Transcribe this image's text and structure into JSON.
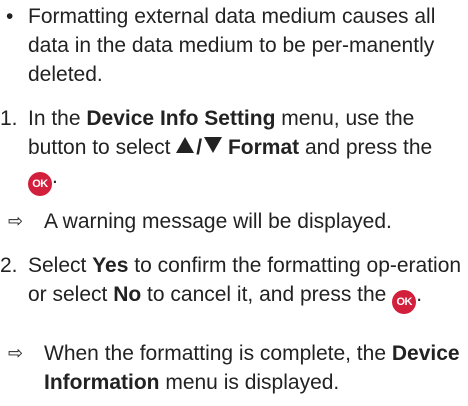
{
  "note": {
    "bullet": "•",
    "text": "Formatting external data medium causes all data in the data medium to be per-manently deleted."
  },
  "step1": {
    "number": "1.",
    "text_a": "In the ",
    "menu_name": "Device Info Setting",
    "text_b": " menu, use the button to select ",
    "slash": "/",
    "format_label": "Format",
    "text_c": " and press the ",
    "ok_icon_label": "OK",
    "text_d": "."
  },
  "result1": {
    "arrow": "⇨",
    "text": "A warning message will be displayed."
  },
  "step2": {
    "number": "2.",
    "text_a": "Select ",
    "yes_label": "Yes",
    "text_b": " to confirm the formatting op-eration or select ",
    "no_label": "No",
    "text_c": " to cancel it, and press the ",
    "ok_icon_label": "OK",
    "text_d": "."
  },
  "result2": {
    "arrow": "⇨",
    "text_a": "When the formatting is complete, the ",
    "menu_name": "Device Information",
    "text_b": " menu is displayed."
  },
  "icons": {
    "ok_button_icon": "ok-button-icon",
    "up_triangle": "up-triangle-icon",
    "down_triangle": "down-triangle-icon",
    "ok_color": "#d21f3c"
  }
}
